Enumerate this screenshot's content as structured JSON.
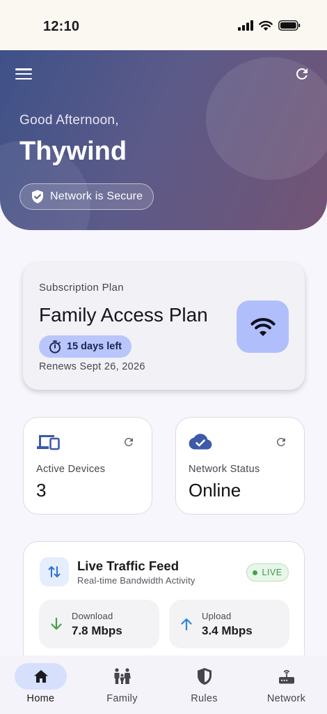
{
  "status_bar": {
    "time": "12:10"
  },
  "header": {
    "greeting": "Good Afternoon,",
    "user_name": "Thywind",
    "security_chip": "Network is Secure",
    "icons": {
      "menu": "menu-icon",
      "refresh": "refresh-icon",
      "security": "shield-check-icon"
    }
  },
  "subscription": {
    "label": "Subscription Plan",
    "plan_name": "Family Access Plan",
    "days_left": "15 days left",
    "renews": "Renews Sept 26, 2026",
    "icon": "wifi-icon"
  },
  "stats": [
    {
      "label": "Active Devices",
      "value": "3",
      "icon": "devices-icon"
    },
    {
      "label": "Network Status",
      "value": "Online",
      "icon": "cloud-check-icon"
    }
  ],
  "traffic": {
    "title": "Live Traffic Feed",
    "subtitle": "Real-time Bandwidth Activity",
    "badge": "LIVE",
    "download": {
      "label": "Download",
      "value": "7.8 Mbps"
    },
    "upload": {
      "label": "Upload",
      "value": "3.4 Mbps"
    }
  },
  "nav": [
    {
      "label": "Home",
      "icon": "home-icon",
      "active": true
    },
    {
      "label": "Family",
      "icon": "family-icon",
      "active": false
    },
    {
      "label": "Rules",
      "icon": "shield-icon",
      "active": false
    },
    {
      "label": "Network",
      "icon": "router-icon",
      "active": false
    }
  ],
  "colors": {
    "hero_start": "#3e5188",
    "hero_end": "#735474",
    "accent_blue": "#b0bffc",
    "live_green": "#3fa448"
  }
}
